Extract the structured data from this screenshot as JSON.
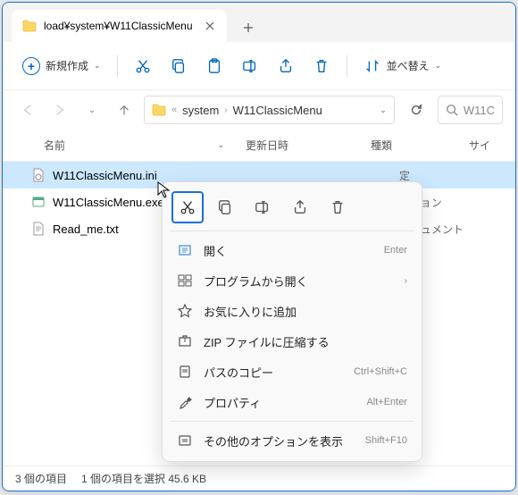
{
  "tab": {
    "title": "load¥system¥W11ClassicMenu"
  },
  "toolbar": {
    "new_label": "新規作成",
    "sort_label": "並べ替え"
  },
  "breadcrumb": {
    "seg1": "system",
    "seg2": "W11ClassicMenu"
  },
  "search": {
    "placeholder": "W11C"
  },
  "columns": {
    "name": "名前",
    "date": "更新日時",
    "type": "種類",
    "size": "サイ"
  },
  "files": [
    {
      "name": "W11ClassicMenu.ini",
      "extra": "定"
    },
    {
      "name": "W11ClassicMenu.exe",
      "extra": "ーション"
    },
    {
      "name": "Read_me.txt",
      "extra": "ドキュメント"
    }
  ],
  "status": {
    "count": "3 個の項目",
    "selected": "1 個の項目を選択 45.6 KB"
  },
  "context": {
    "open": {
      "label": "開く",
      "accel": "Enter"
    },
    "openwith": {
      "label": "プログラムから開く"
    },
    "favorite": {
      "label": "お気に入りに追加"
    },
    "zip": {
      "label": "ZIP ファイルに圧縮する"
    },
    "copypath": {
      "label": "パスのコピー",
      "accel": "Ctrl+Shift+C"
    },
    "properties": {
      "label": "プロパティ",
      "accel": "Alt+Enter"
    },
    "moreoptions": {
      "label": "その他のオプションを表示",
      "accel": "Shift+F10"
    }
  }
}
